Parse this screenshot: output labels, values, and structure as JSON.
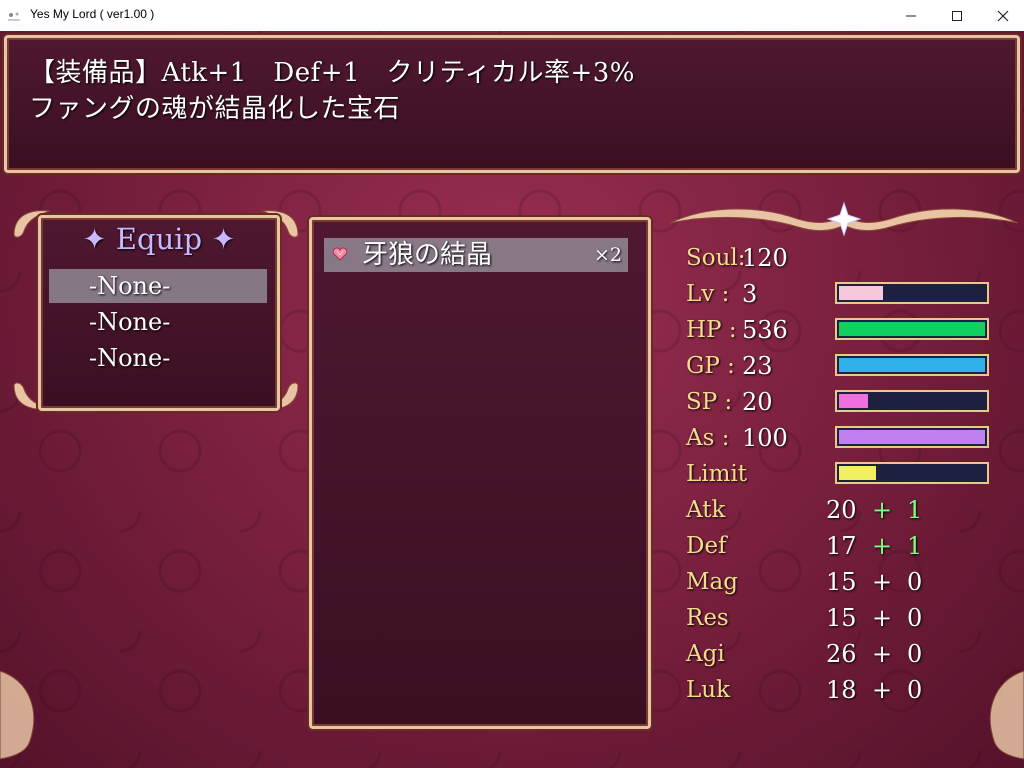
{
  "window": {
    "title": "Yes My Lord ( ver1.00 )",
    "minimize_glyph": "—",
    "maximize_glyph": "☐",
    "close_glyph": "✕"
  },
  "help": {
    "line1": "【装備品】Atk+1　Def+1　クリティカル率+3%",
    "line2": "ファングの魂が結晶化した宝石"
  },
  "equip": {
    "title": "✦ Equip ✦",
    "slots": [
      "-None-",
      "-None-",
      "-None-"
    ],
    "selected_index": 0
  },
  "items": [
    {
      "icon": "heart-gem-icon",
      "name": "牙狼の結晶",
      "count": "×2"
    }
  ],
  "stats": {
    "soul_label": "Soul",
    "soul": "120",
    "lv_label": "Lv",
    "lv": "3",
    "lv_fraction": 0.3,
    "hp_label": "HP",
    "hp": "536",
    "hp_fraction": 1.0,
    "gp_label": "GP",
    "gp": "23",
    "gp_fraction": 1.0,
    "sp_label": "SP",
    "sp": "20",
    "sp_fraction": 0.2,
    "as_label": "As",
    "as": "100",
    "as_fraction": 1.0,
    "limit_label": "Limit",
    "limit_fraction": 0.25,
    "colon": ":",
    "params": [
      {
        "name": "Atk",
        "base": "20",
        "plus": "+",
        "bonus": "1",
        "bonus_color": "green"
      },
      {
        "name": "Def",
        "base": "17",
        "plus": "+",
        "bonus": "1",
        "bonus_color": "green"
      },
      {
        "name": "Mag",
        "base": "15",
        "plus": "+",
        "bonus": "0",
        "bonus_color": "white"
      },
      {
        "name": "Res",
        "base": "15",
        "plus": "+",
        "bonus": "0",
        "bonus_color": "white"
      },
      {
        "name": "Agi",
        "base": "26",
        "plus": "+",
        "bonus": "0",
        "bonus_color": "white"
      },
      {
        "name": "Luk",
        "base": "18",
        "plus": "+",
        "bonus": "0",
        "bonus_color": "white"
      }
    ]
  },
  "colors": {
    "lv_bar": "#f5c8dc",
    "hp_bar": "#10d060",
    "gp_bar": "#30b0e8",
    "sp_bar": "#f070e0",
    "as_bar": "#c080f0",
    "limit_bar": "#f0f060",
    "label": "#f4dc8c",
    "bonus_green": "#7dff7d"
  }
}
